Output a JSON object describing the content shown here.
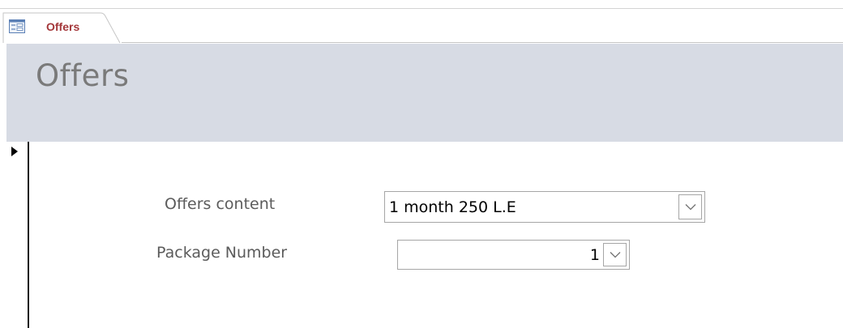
{
  "tab": {
    "label": "Offers",
    "icon": "form-icon"
  },
  "form": {
    "title": "Offers"
  },
  "fields": {
    "offers_content": {
      "label": "Offers content",
      "value": "1 month 250 L.E"
    },
    "package_number": {
      "label": "Package Number",
      "value": "1"
    }
  },
  "colors": {
    "header_bg": "#d7dbe4",
    "tab_text": "#a4373a",
    "title_text": "#7a7a7a",
    "label_text": "#5b5b5b"
  },
  "icons": {
    "record_selector": "current-record-arrow-icon",
    "dropdown": "chevron-down-icon"
  }
}
